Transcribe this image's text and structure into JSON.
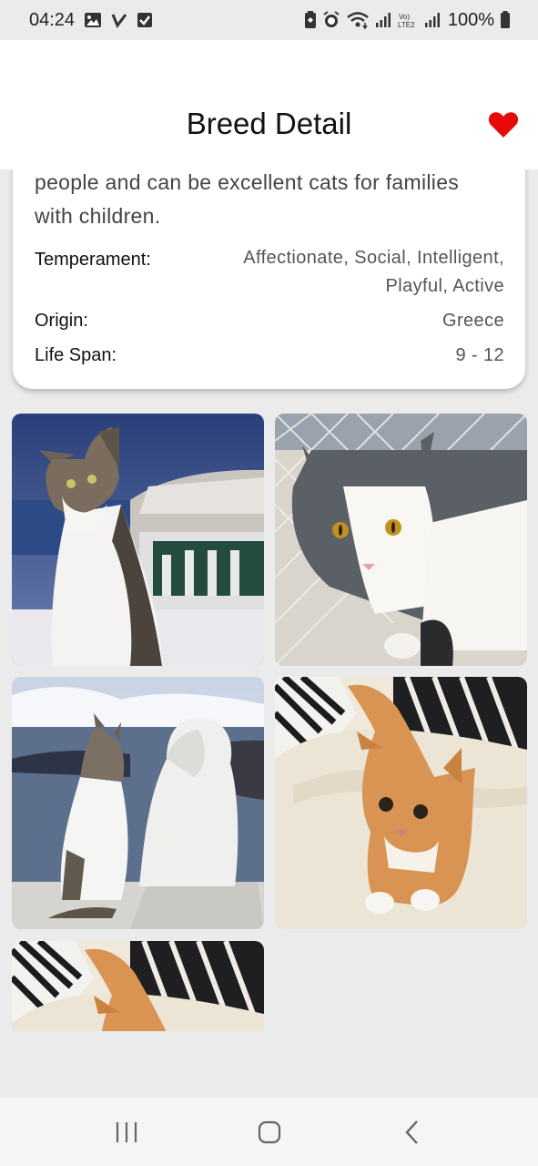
{
  "status_bar": {
    "time": "04:24",
    "battery": "100%",
    "left_icons": [
      "gallery-icon",
      "check-v-icon",
      "checkbox-icon"
    ],
    "right_icons": [
      "nfc-icon",
      "alarm-icon",
      "wifi-icon",
      "signal-icon",
      "volte-icon",
      "signal-2-icon",
      "battery-icon"
    ]
  },
  "app_bar": {
    "title": "Breed Detail",
    "favorite_icon": "heart-icon",
    "favorite_color": "#e8090a"
  },
  "breed": {
    "description_tail": "people and can be excellent cats for families with children.",
    "temperament_label": "Temperament:",
    "temperament_value": "Affectionate, Social, Intelligent, Playful, Active",
    "origin_label": "Origin:",
    "origin_value": "Greece",
    "life_span_label": "Life Span:",
    "life_span_value": "9 - 12"
  },
  "photos": [
    {
      "name": "cat-photo-tabby-white-santorini"
    },
    {
      "name": "cat-photo-grey-white-fence"
    },
    {
      "name": "cat-photo-tabby-lion-statue"
    },
    {
      "name": "cat-photo-orange-tabby-bed"
    },
    {
      "name": "cat-photo-orange-tabby-bed-2"
    }
  ],
  "nav_bar": {
    "recents_icon": "recents-icon",
    "home_icon": "home-icon",
    "back_icon": "back-icon"
  }
}
